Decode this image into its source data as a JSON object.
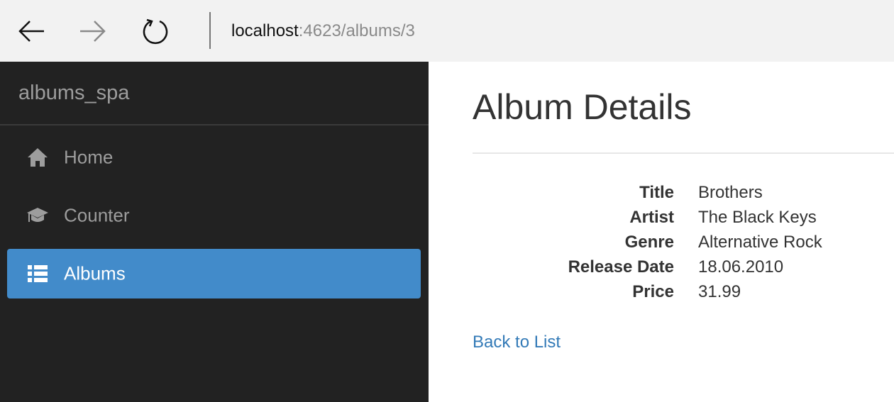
{
  "browser": {
    "url_host": "localhost",
    "url_rest": ":4623/albums/3",
    "back_icon": "back-arrow-icon",
    "forward_icon": "forward-arrow-icon",
    "refresh_icon": "refresh-icon"
  },
  "sidebar": {
    "brand": "albums_spa",
    "items": [
      {
        "label": "Home",
        "icon": "home-icon",
        "active": false
      },
      {
        "label": "Counter",
        "icon": "graduation-cap-icon",
        "active": false
      },
      {
        "label": "Albums",
        "icon": "list-icon",
        "active": true
      }
    ]
  },
  "main": {
    "title": "Album Details",
    "details": [
      {
        "label": "Title",
        "value": "Brothers"
      },
      {
        "label": "Artist",
        "value": "The Black Keys"
      },
      {
        "label": "Genre",
        "value": "Alternative Rock"
      },
      {
        "label": "Release Date",
        "value": "18.06.2010"
      },
      {
        "label": "Price",
        "value": "31.99"
      }
    ],
    "back_link": "Back to List"
  },
  "colors": {
    "sidebar_bg": "#222222",
    "active_item_bg": "#428bca",
    "link": "#337ab7",
    "browser_bar_bg": "#f2f2f2"
  }
}
